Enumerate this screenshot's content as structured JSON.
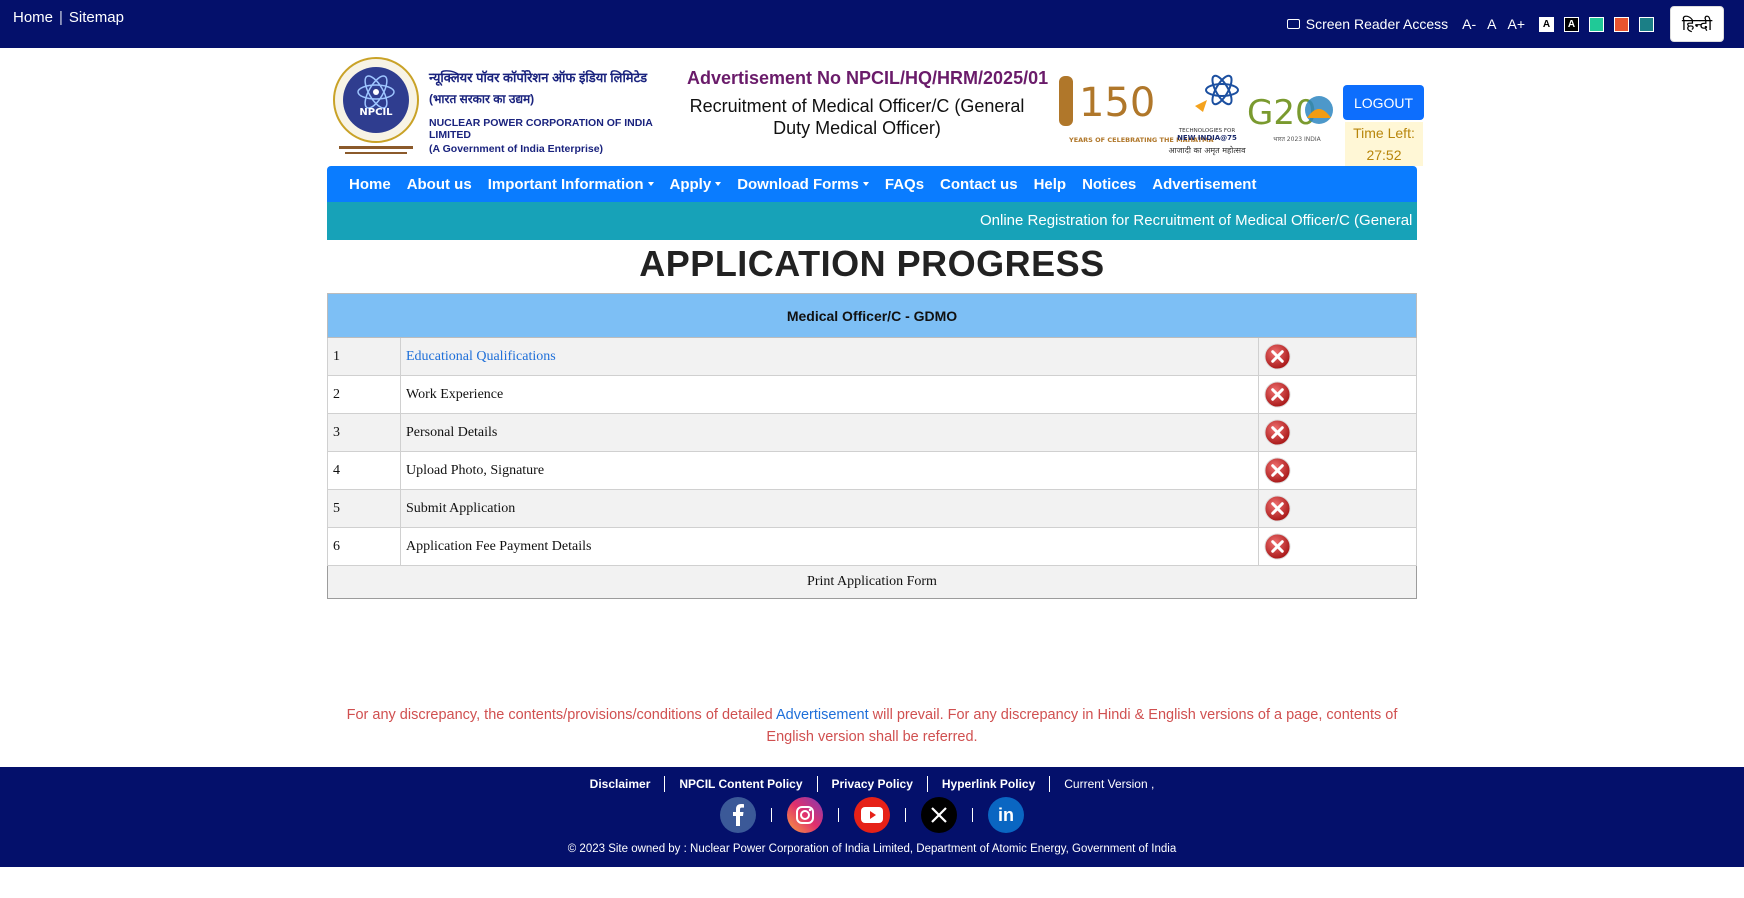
{
  "topbar": {
    "home": "Home",
    "sitemap": "Sitemap",
    "screen_reader": "Screen Reader Access",
    "font_decrease": "A-",
    "font_normal": "A",
    "font_increase": "A+",
    "contrast_light": "A",
    "contrast_dark": "A",
    "hindi": "हिन्दी"
  },
  "header": {
    "org_hindi": "न्यूक्लियर पॉवर कॉर्पोरेशन ऑफ इंडिया लिमिटेड",
    "org_hindi_sub": "(भारत सरकार का उद्यम)",
    "org_english": "NUCLEAR POWER CORPORATION OF INDIA LIMITED",
    "org_english_sub": "(A Government of India Enterprise)",
    "emblem_text": "NPCIL",
    "advertisement_no": "Advertisement No NPCIL/HQ/HRM/2025/01",
    "post_title": "Recruitment of Medical Officer/C (General Duty Medical Officer)",
    "badge_150_number": "150",
    "badge_150_text": "YEARS OF CELEBRATING THE MAHATMA",
    "badge_india75_line1": "TECHNOLOGIES FOR",
    "badge_india75_line2": "NEW INDIA@75",
    "badge_india75_line3": "आजादी का अमृत महोत्सव",
    "badge_g20": "G20",
    "badge_g20_sub": "भारत 2023 INDIA",
    "logout": "LOGOUT",
    "time_left_label": "Time Left:",
    "time_left_value": "27:52"
  },
  "nav": {
    "items": [
      "Home",
      "About us",
      "Important Information",
      "Apply",
      "Download Forms",
      "FAQs",
      "Contact us",
      "Help",
      "Notices",
      "Advertisement"
    ]
  },
  "marquee": "Online Registration for Recruitment of Medical Officer/C (General D",
  "page_title": "APPLICATION PROGRESS",
  "table": {
    "heading": "Medical Officer/C - GDMO",
    "rows": [
      {
        "num": "1",
        "label": "Educational Qualifications"
      },
      {
        "num": "2",
        "label": "Work Experience"
      },
      {
        "num": "3",
        "label": "Personal Details"
      },
      {
        "num": "4",
        "label": "Upload Photo, Signature"
      },
      {
        "num": "5",
        "label": "Submit Application"
      },
      {
        "num": "6",
        "label": "Application Fee Payment Details"
      }
    ],
    "print": "Print Application Form"
  },
  "disclaimer": {
    "pre": "For any discrepancy, the contents/provisions/conditions of detailed ",
    "link": "Advertisement",
    "post": " will prevail. For any discrepancy in Hindi & English versions of a page, contents of English version shall be referred."
  },
  "footer": {
    "links": [
      "Disclaimer",
      "NPCIL Content Policy",
      "Privacy Policy",
      "Hyperlink Policy",
      "Current Version ,"
    ],
    "social_icons": [
      "facebook-icon",
      "instagram-icon",
      "youtube-icon",
      "x-icon",
      "linkedin-icon"
    ],
    "linkedin_text": "in",
    "copyright": "© 2023 Site owned by : Nuclear Power Corporation of India Limited, Department of Atomic Energy, Government of India"
  },
  "colors": {
    "topbar": "#04106b",
    "nav": "#0a7cff",
    "marquee": "#17a2b8",
    "table_header": "#7dbff5",
    "swatch_green": "#20c997",
    "swatch_orange": "#e8542f",
    "swatch_teal": "#1b7f86"
  }
}
